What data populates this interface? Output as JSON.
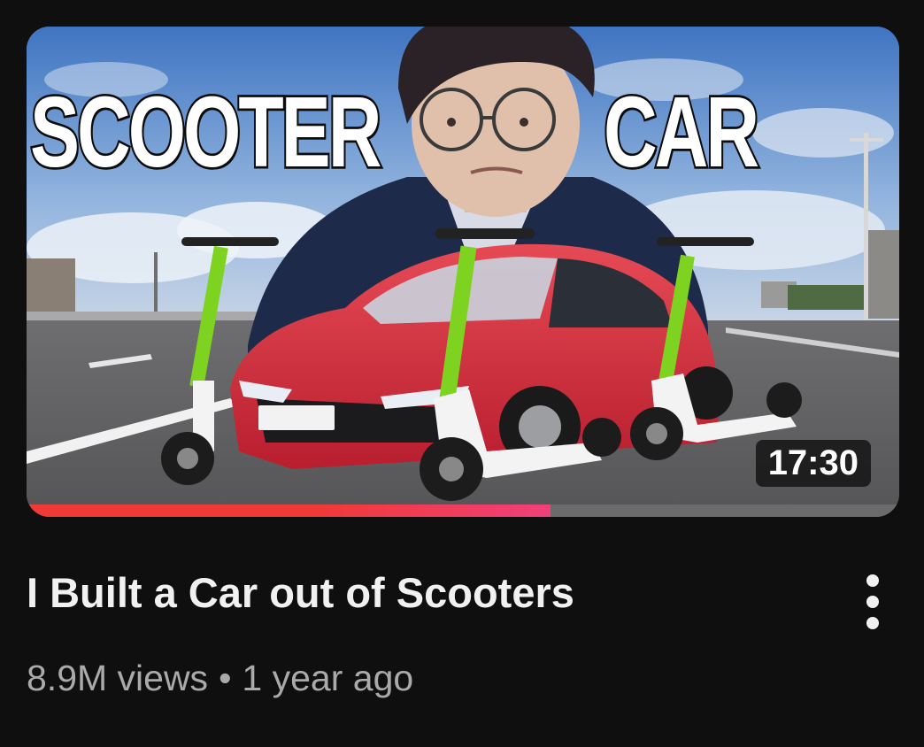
{
  "video": {
    "thumbnail": {
      "text_left": "SCOOTER",
      "text_right": "CAR",
      "duration": "17:30",
      "watch_progress": 0.6
    },
    "title": "I Built a Car out of Scooters",
    "views": "8.9M views",
    "separator": "•",
    "age": "1 year ago",
    "menu_icon": "more-vertical-icon"
  },
  "colors": {
    "background": "#0f0f0f",
    "title": "#f1f1f1",
    "meta": "#aaaaaa",
    "progress": "#f03a36"
  }
}
